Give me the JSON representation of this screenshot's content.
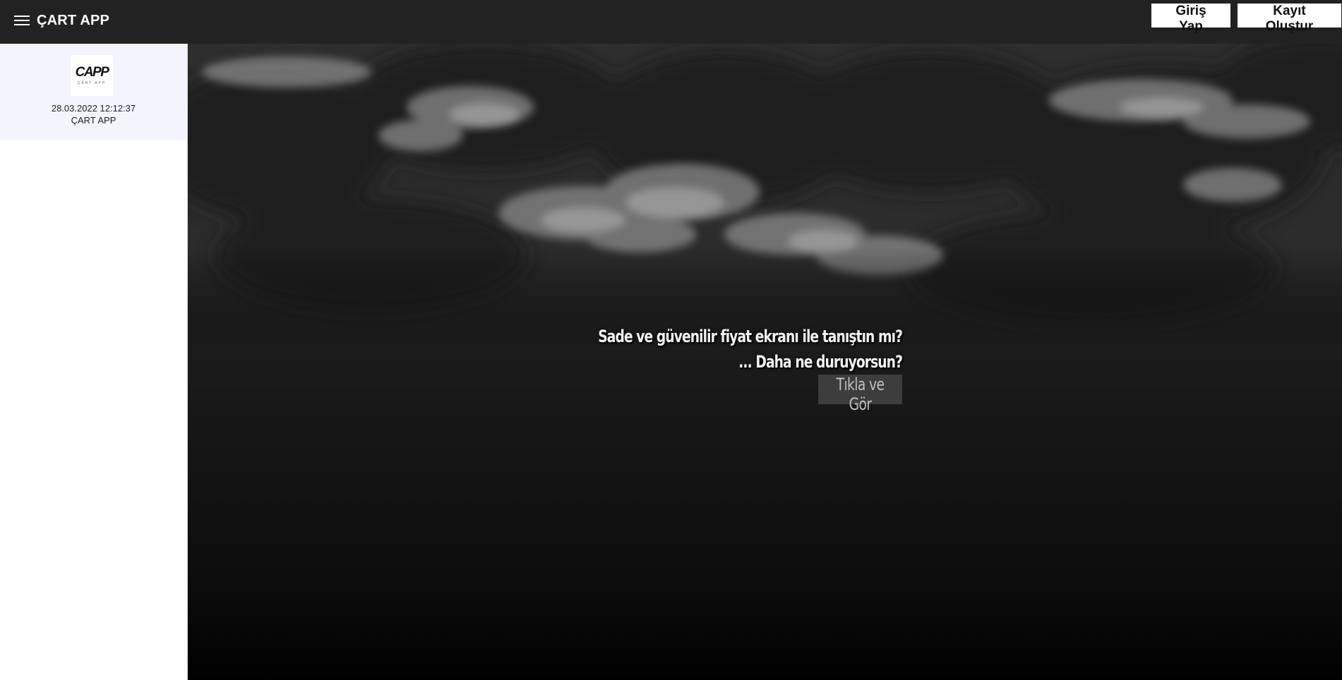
{
  "header": {
    "title": "ÇART APP",
    "menu_icon": "hamburger-menu-icon",
    "login_label": "Giriş Yap",
    "register_label": "Kayıt Oluştur"
  },
  "sidebar": {
    "card": {
      "logo_text": "CAPP",
      "logo_subtext": "ÇART APP",
      "datetime": "28.03.2022 12:12:37",
      "name": "ÇART APP"
    }
  },
  "hero": {
    "line1": "Sade ve güvenilir fiyat ekranı ile tanıştın mı?",
    "line2": "... Daha ne duruyorsun?",
    "cta_label": "Tıkla ve Gör"
  },
  "colors": {
    "topbar": "#222222",
    "sidebar_card": "#f3f4fd",
    "cta_background": "#3d3d3d"
  }
}
